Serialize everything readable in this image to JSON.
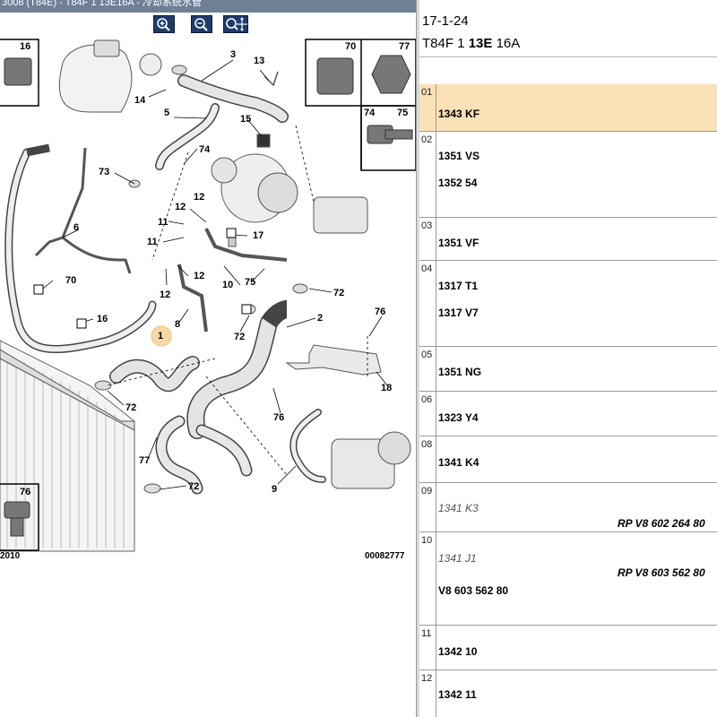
{
  "window": {
    "title": "3008 (T84E) - T84F 1 13E16A - 冷却系统水管"
  },
  "toolbar": {
    "buttons": [
      {
        "name": "zoom-in-icon"
      },
      {
        "name": "zoom-out-icon"
      },
      {
        "name": "zoom-fit-icon"
      }
    ]
  },
  "diagram": {
    "reference": "00082777",
    "year": "2010",
    "callouts": {
      "c16a": "16",
      "c70a": "70",
      "c77a": "77",
      "c74a": "74",
      "c75a": "75",
      "c3": "3",
      "c13": "13",
      "c14": "14",
      "c5": "5",
      "c15": "15",
      "c74b": "74",
      "c73": "73",
      "c12a": "12",
      "c12b": "12",
      "c11a": "11",
      "c17": "17",
      "c11b": "11",
      "c6": "6",
      "c12c": "12",
      "c12d": "12",
      "c10": "10",
      "c75b": "75",
      "c70b": "70",
      "c72a": "72",
      "c16b": "16",
      "c8": "8",
      "c72b": "72",
      "c2": "2",
      "c76a": "76",
      "c1": "1",
      "c72c": "72",
      "c18": "18",
      "c76b": "76",
      "c77b": "77",
      "c9": "9",
      "c72d": "72",
      "c76c": "76"
    }
  },
  "header": {
    "date": "17-1-24",
    "code_prefix": "T84F 1",
    "code_bold": "13E",
    "code_suffix": "16A"
  },
  "rows": [
    {
      "num": "01",
      "refs": [
        "1343 KF"
      ],
      "selected": true
    },
    {
      "num": "02",
      "refs": [
        "1351 VS",
        "1352 54"
      ]
    },
    {
      "num": "03",
      "refs": [
        "1351 VF"
      ]
    },
    {
      "num": "04",
      "refs": [
        "1317 T1",
        "1317 V7"
      ]
    },
    {
      "num": "05",
      "refs": [
        "1351 NG"
      ]
    },
    {
      "num": "06",
      "refs": [
        "1323 Y4"
      ]
    },
    {
      "num": "08",
      "refs": [
        "1341 K4"
      ]
    },
    {
      "num": "09",
      "ref_italic": "1341 K3",
      "replacement": "RP V8 602 264 80"
    },
    {
      "num": "10",
      "ref_italic": "1341 J1",
      "replacement": "RP V8 603 562 80",
      "ref_extra": "V8 603 562 80"
    },
    {
      "num": "11",
      "refs": [
        "1342 10"
      ]
    },
    {
      "num": "12",
      "refs": [
        "1342 11"
      ]
    }
  ],
  "colors": {
    "titlebar": "#6f7f96",
    "toolbar_button": "#1f3b6a",
    "selected_row": "#fbe1b6",
    "grid_line": "#9a9a9a"
  }
}
